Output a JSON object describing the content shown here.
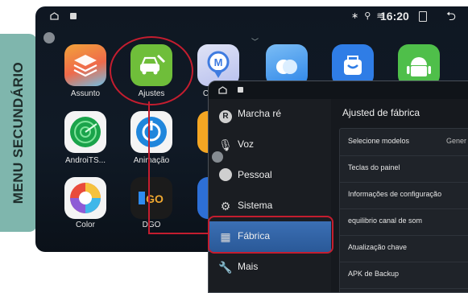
{
  "side_label": "MENU SECUNDÁRIO",
  "status_bar": {
    "time": "16:20",
    "indicators": "∗ ⚲ ≋"
  },
  "apps": [
    {
      "label": "Assunto",
      "icon": "layers-theme-icon"
    },
    {
      "label": "Ajustes",
      "icon": "car-settings-icon"
    },
    {
      "label": "CarMate",
      "icon": "map-pin-icon"
    },
    {
      "label": "",
      "icon": "cloud-icon"
    },
    {
      "label": "",
      "icon": "shopping-bag-icon"
    },
    {
      "label": "",
      "icon": "android-icon"
    },
    {
      "label": "AndroiTS...",
      "icon": "gps-test-icon"
    },
    {
      "label": "Animação",
      "icon": "power-circle-icon"
    },
    {
      "label": "Color",
      "icon": "color-wheel-icon"
    },
    {
      "label": "DGO",
      "icon": "dgo-logo-icon"
    }
  ],
  "settings_menu": {
    "items": [
      {
        "label": "Marcha ré",
        "icon": "r-gear-icon"
      },
      {
        "label": "Voz",
        "icon": "microphone-icon"
      },
      {
        "label": "Pessoal",
        "icon": "person-icon"
      },
      {
        "label": "Sistema",
        "icon": "gears-icon"
      },
      {
        "label": "Fábrica",
        "icon": "factory-icon"
      },
      {
        "label": "Mais",
        "icon": "wrench-icon"
      }
    ],
    "active_index": 4
  },
  "factory_pane": {
    "title": "Ajusted de fábrica",
    "rows": [
      {
        "label": "Selecione modelos",
        "value": "Gener"
      },
      {
        "label": "Teclas do painel",
        "value": ""
      },
      {
        "label": "Informações de configuração",
        "value": ""
      },
      {
        "label": "equilibrio canal de som",
        "value": ""
      },
      {
        "label": "Atualização chave",
        "value": ""
      },
      {
        "label": "APK de Backup",
        "value": ""
      }
    ]
  },
  "colors": {
    "accent_red": "#c41d2f",
    "tab_green": "#7fb6ad",
    "active_blue": "#3b6fb4"
  }
}
